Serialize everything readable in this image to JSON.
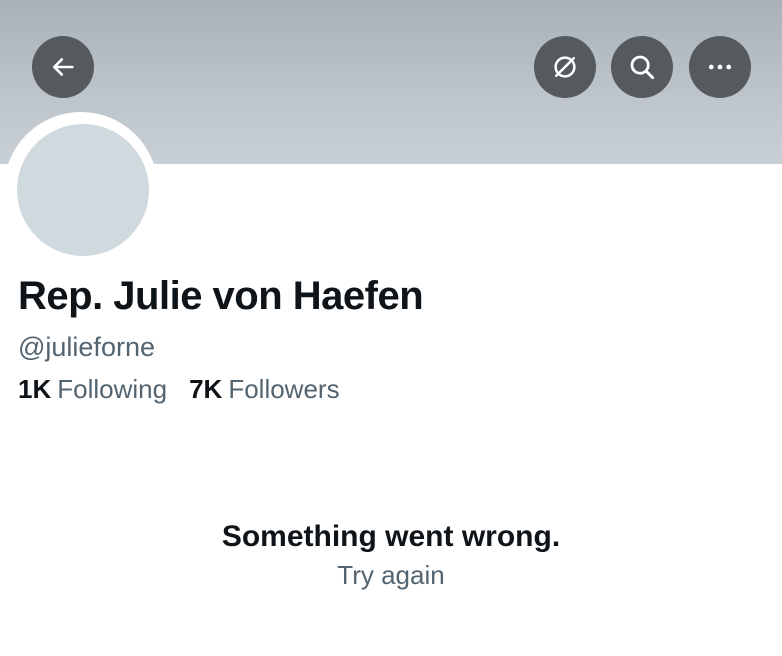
{
  "header": {
    "icons": [
      "back-arrow-icon",
      "translate-off-icon",
      "search-icon",
      "more-dots-icon"
    ],
    "button_color": "#555a5f",
    "banner_color": "#b3bbc1"
  },
  "profile": {
    "display_name": "Rep. Julie von Haefen",
    "handle": "@julieforne",
    "following_count": "1K",
    "following_label": "Following",
    "followers_count": "7K",
    "followers_label": "Followers",
    "avatar_color": "#cfd9de"
  },
  "error": {
    "message": "Something went wrong.",
    "retry_label": "Try again"
  }
}
